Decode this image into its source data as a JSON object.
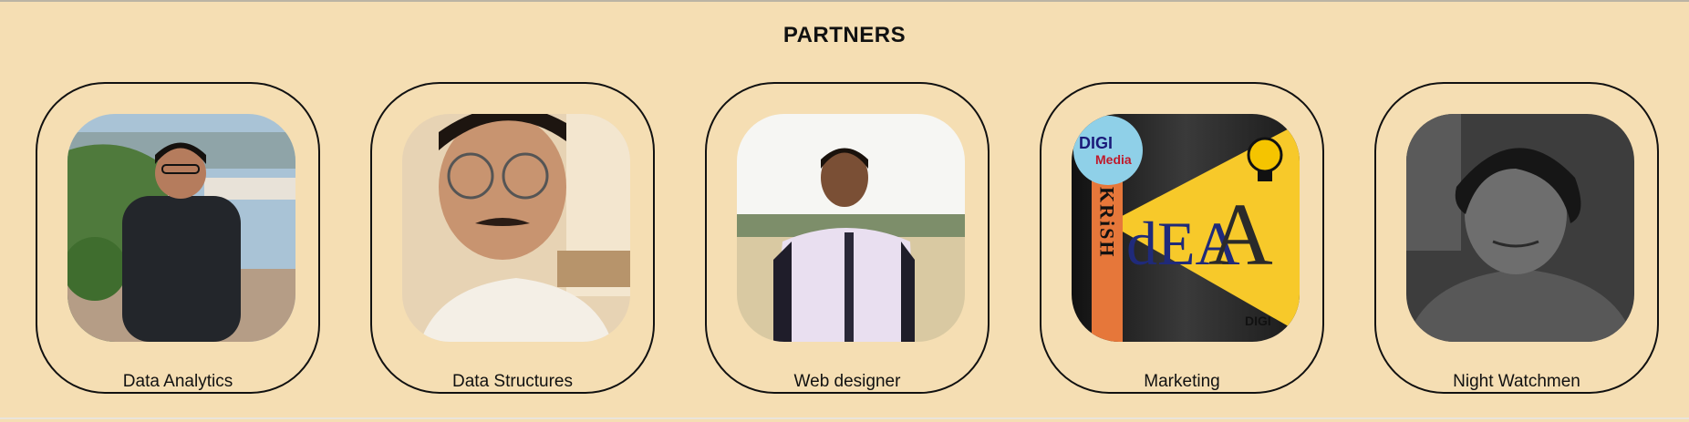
{
  "section": {
    "title": "PARTNERS"
  },
  "partners": [
    {
      "role": "Data Analytics",
      "photo": "portrait-photo"
    },
    {
      "role": "Data Structures",
      "photo": "portrait-photo"
    },
    {
      "role": "Web designer",
      "photo": "portrait-photo"
    },
    {
      "role": "Marketing",
      "photo": "logo-image"
    },
    {
      "role": "Night Watchmen",
      "photo": "portrait-photo"
    }
  ],
  "logo": {
    "badge_top": "DIGI",
    "badge_bottom": "Media",
    "vertical_name": "KRiSH",
    "word_left": "dEA",
    "word_right": "A",
    "mark": "DIGI"
  }
}
